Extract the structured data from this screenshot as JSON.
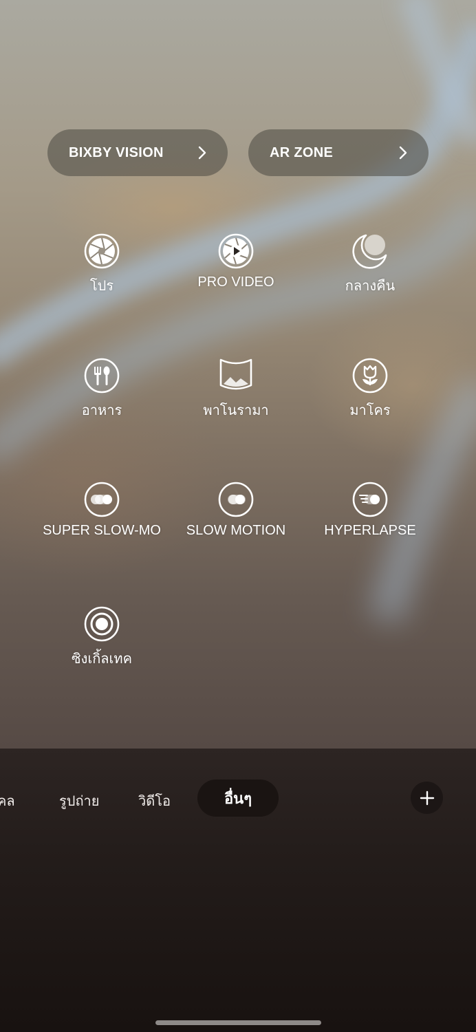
{
  "quick_actions": {
    "bixby": "BIXBY VISION",
    "ar_zone": "AR ZONE"
  },
  "modes": {
    "pro": "โปร",
    "pro_video": "PRO VIDEO",
    "night": "กลางคืน",
    "food": "อาหาร",
    "panorama": "พาโนรามา",
    "macro": "มาโคร",
    "super_slow_mo": "SUPER SLOW-MO",
    "slow_motion": "SLOW MOTION",
    "hyperlapse": "HYPERLAPSE",
    "single_take": "ซิงเกิ้ลเทค"
  },
  "mode_bar": {
    "partial": "คล",
    "photo": "รูปถ่าย",
    "video": "วิดีโอ",
    "more": "อื่นๆ",
    "add_icon": "plus-icon"
  },
  "icons": {
    "pro": "aperture-icon",
    "pro_video": "aperture-play-icon",
    "night": "moon-icon",
    "food": "fork-spoon-icon",
    "panorama": "panorama-icon",
    "macro": "flower-icon",
    "super_slow_mo": "super-slow-icon",
    "slow_motion": "slow-motion-icon",
    "hyperlapse": "hyperlapse-icon",
    "single_take": "single-take-icon",
    "chevron": "chevron-right-icon"
  },
  "colors": {
    "pill_bg": "#4b4842",
    "bottom_bg": "#231c1a",
    "active_tab_bg": "#1a1412"
  }
}
